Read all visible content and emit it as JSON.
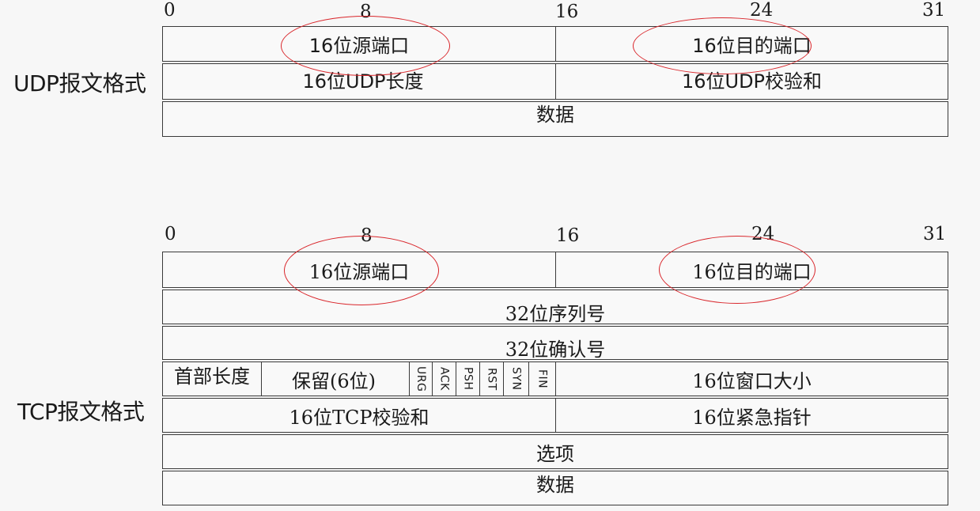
{
  "bit_labels": [
    "0",
    "8",
    "16",
    "24",
    "31"
  ],
  "udp": {
    "title": "UDP报文格式",
    "rows": {
      "src_port": "16位源端口",
      "dst_port": "16位目的端口",
      "length": "16位UDP长度",
      "checksum": "16位UDP校验和",
      "data": "数据"
    }
  },
  "tcp": {
    "title": "TCP报文格式",
    "rows": {
      "src_port": "16位源端口",
      "dst_port": "16位目的端口",
      "seq": "32位序列号",
      "ack_num": "32位确认号",
      "header_len": "首部长度",
      "reserved": "保留(6位)",
      "flags": [
        "URG",
        "ACK",
        "PSH",
        "RST",
        "SYN",
        "FIN"
      ],
      "window": "16位窗口大小",
      "checksum": "16位TCP校验和",
      "urgent": "16位紧急指针",
      "options": "选项",
      "data": "数据"
    }
  },
  "colors": {
    "highlight_oval": "#d9262b",
    "border": "#3a3a3a"
  }
}
